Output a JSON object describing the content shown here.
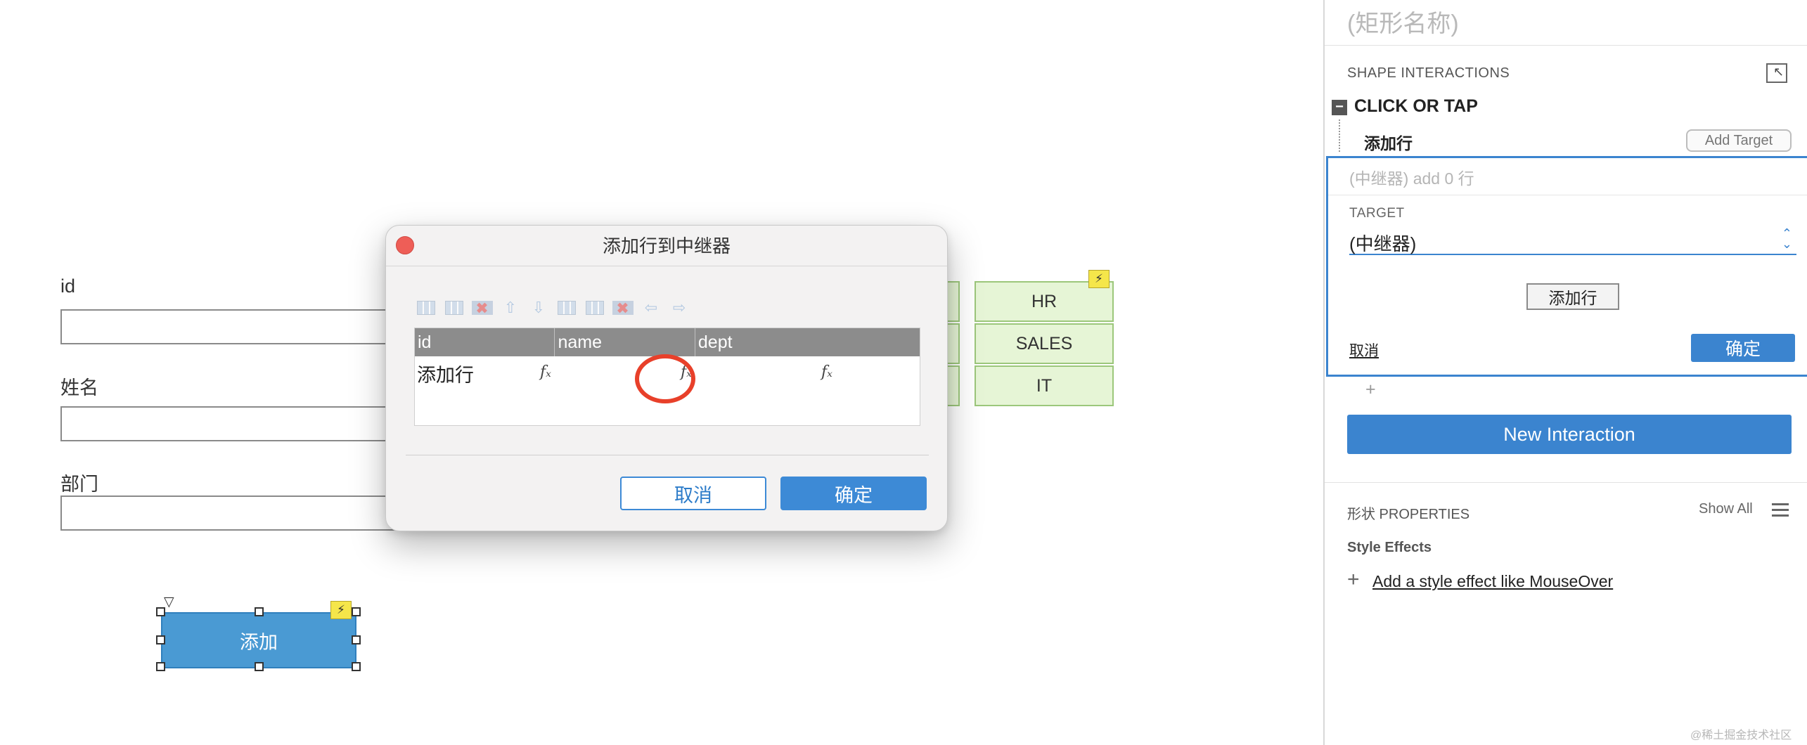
{
  "form": {
    "fields": [
      {
        "label": "id"
      },
      {
        "label": "姓名"
      },
      {
        "label": "部门"
      }
    ],
    "add_button_label": "添加"
  },
  "repeater": {
    "visible_depts": [
      "HR",
      "SALES",
      "IT"
    ]
  },
  "dialog": {
    "title": "添加行到中继器",
    "columns": [
      "id",
      "name",
      "dept"
    ],
    "row_label": "添加行",
    "fx_symbol": "𝑓ₓ",
    "cancel_label": "取消",
    "ok_label": "确定"
  },
  "panel": {
    "shape_name": "(矩形名称)",
    "interactions_title": "SHAPE INTERACTIONS",
    "event": "CLICK OR TAP",
    "action_name": "添加行",
    "add_target_label": "Add Target",
    "action_summary": "(中继器) add 0 行",
    "target_label": "TARGET",
    "target_value": "(中继器)",
    "add_row_button": "添加行",
    "cancel_link": "取消",
    "confirm_label": "确定",
    "plus": "+",
    "new_interaction_label": "New Interaction",
    "properties_title": "形状 PROPERTIES",
    "show_all_label": "Show All",
    "style_effects_label": "Style Effects",
    "add_style_effect_label": "Add a style effect like MouseOver"
  },
  "watermark": "@稀土掘金技术社区",
  "colors": {
    "accent_blue": "#3b84cf",
    "repeater_fill": "#e6f5d6",
    "highlight_ring": "#e8402a",
    "lightning_badge": "#f5e64a"
  },
  "icons": [
    "lightning-icon",
    "close-dot-icon",
    "fx-icon",
    "collapse-panel-icon",
    "menu-icon",
    "plus-icon"
  ]
}
